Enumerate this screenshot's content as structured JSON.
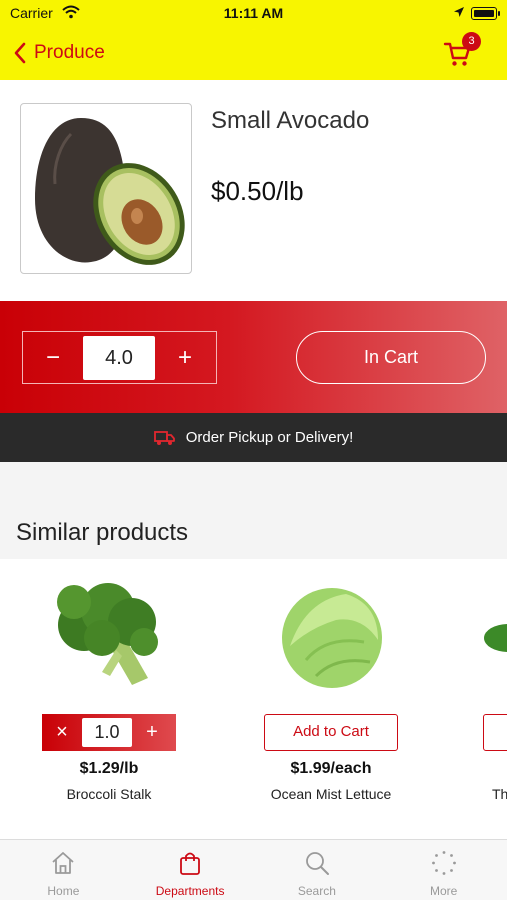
{
  "status_bar": {
    "carrier": "Carrier",
    "time": "11:11 AM"
  },
  "nav": {
    "back_label": "Produce",
    "cart_count": "3"
  },
  "product": {
    "name": "Small Avocado",
    "price": "$0.50/lb",
    "image_icon": "avocado-image"
  },
  "quantity": {
    "minus": "−",
    "value": "4.0",
    "plus": "+",
    "cart_button": "In Cart"
  },
  "banner": {
    "text": "Order Pickup or Delivery!"
  },
  "similar": {
    "title": "Similar products",
    "items": [
      {
        "name": "Broccoli Stalk",
        "price": "$1.29/lb",
        "qty": "1.0",
        "remove": "×",
        "add": "+"
      },
      {
        "name": "Ocean Mist Lettuce",
        "price": "$1.99/each",
        "button": "Add to Cart"
      },
      {
        "name": "Th"
      }
    ]
  },
  "tabs": [
    {
      "label": "Home",
      "icon": "home-icon"
    },
    {
      "label": "Departments",
      "icon": "shopping-bag-icon",
      "active": true
    },
    {
      "label": "Search",
      "icon": "search-icon"
    },
    {
      "label": "More",
      "icon": "more-dots-icon"
    }
  ],
  "colors": {
    "accent": "#cc0a14",
    "header": "#f8f500",
    "banner": "#2a2a2a"
  }
}
